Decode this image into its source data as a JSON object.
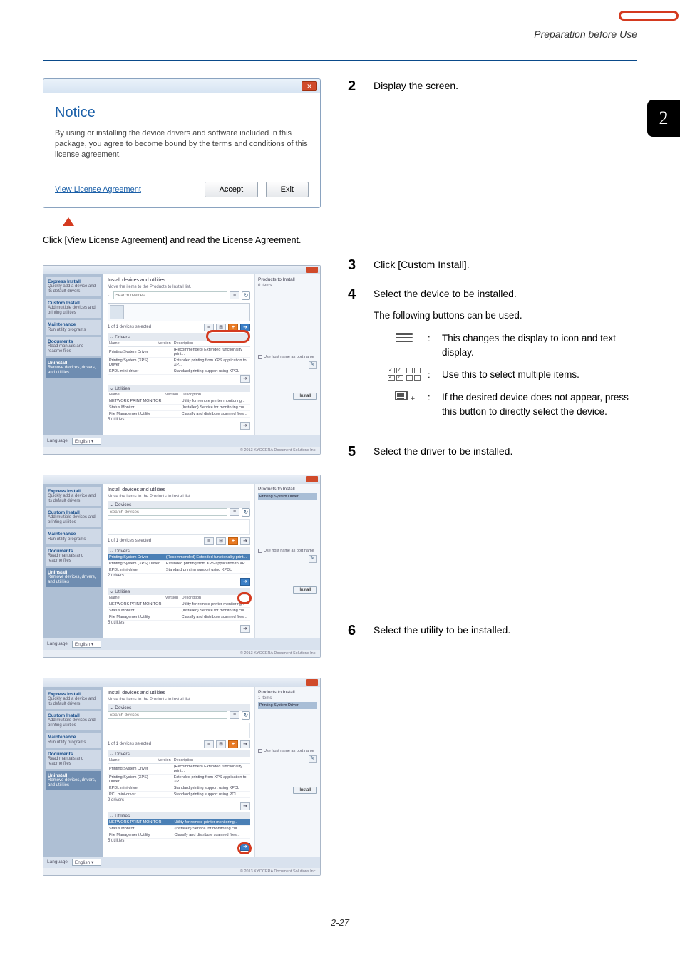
{
  "header": {
    "title": "Preparation before Use"
  },
  "chapter": "2",
  "page_number": "2-27",
  "notice_dialog": {
    "title_faint": "",
    "heading": "Notice",
    "body": "By using or installing the device drivers and software included in this package, you agree to become bound by the terms and conditions of this license agreement.",
    "link": "View License Agreement",
    "accept": "Accept",
    "exit": "Exit"
  },
  "caption1": "Click [View License Agreement] and read the License Agreement.",
  "steps": {
    "s2": "Display the screen.",
    "s3": "Click [Custom Install].",
    "s4": {
      "main": "Select the device to be installed.",
      "sub": "The following buttons can be used.",
      "icon1": "This changes the display to icon and text display.",
      "icon2": "Use this to select multiple items.",
      "icon3": "If the desired device does not appear, press this button to directly select the device."
    },
    "s5": "Select the driver to be installed.",
    "s6": "Select the utility to be installed."
  },
  "installer": {
    "devices_panel": "Install devices and utilities",
    "instruction": "Move the items to the Products to Install list.",
    "devices_label": "Devices",
    "search_placeholder": "Search devices",
    "selected_count": "1 of 1 devices selected",
    "drivers_label": "Drivers",
    "utilities_label": "Utilities",
    "products_title": "Products to Install",
    "products_count": "0 items",
    "products_count1": "1 items",
    "host_checkbox": "Use host name as port name",
    "install_btn": "Install",
    "lang_label": "Language",
    "lang_value": "English",
    "copyright": "© 2013 KYOCERA Document Solutions Inc.",
    "side": {
      "express": {
        "t": "Express Install",
        "d": "Quickly add a device and its default drivers"
      },
      "custom": {
        "t": "Custom Install",
        "d": "Add multiple devices and printing utilities"
      },
      "maint": {
        "t": "Maintenance",
        "d": "Run utility programs"
      },
      "docs": {
        "t": "Documents",
        "d": "Read manuals and readme files"
      },
      "uninstall": {
        "t": "Uninstall",
        "d": "Remove devices, drivers, and utilities"
      }
    },
    "cols": {
      "name": "Name",
      "version": "Version",
      "description": "Description"
    },
    "drivers": [
      {
        "name": "Printing System Driver",
        "desc": "(Recommended) Extended functionality print..."
      },
      {
        "name": "Printing System (XPS) Driver",
        "desc": "Extended printing from XPS application to XP..."
      },
      {
        "name": "KPDL mini-driver",
        "desc": "Standard printing support using KPDL"
      },
      {
        "name": "PCL mini-driver",
        "desc": "Standard printing support using PCL"
      }
    ],
    "drivers_more": "2 drivers",
    "utilities": [
      {
        "name": "NETWORK PRINT MONITOR",
        "desc": "Utility for remote printer monitoring..."
      },
      {
        "name": "Status Monitor",
        "desc": "(Installed) Service for monitoring cur..."
      },
      {
        "name": "File Management Utility",
        "desc": "Classify and distribute scanned files..."
      }
    ],
    "utilities_more": "5 utilities",
    "right_item": "Printing System Driver"
  }
}
